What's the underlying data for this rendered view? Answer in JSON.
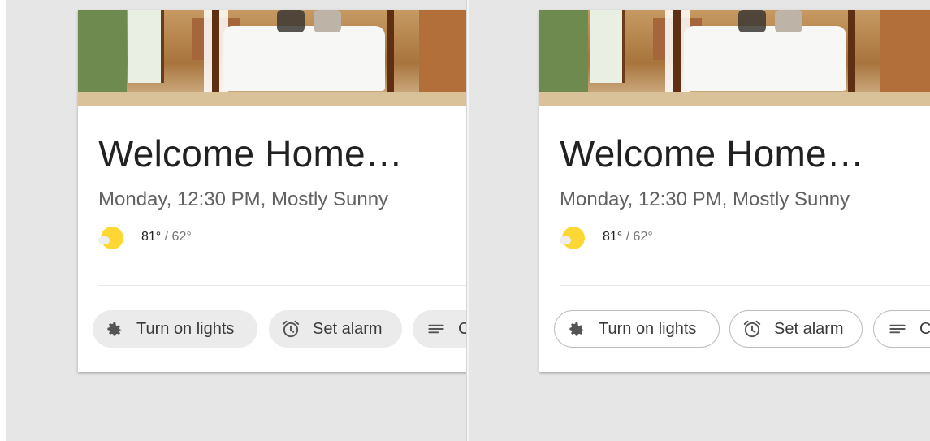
{
  "variants": [
    {
      "style": "filled-chips",
      "card": {
        "title": "Welcome Home…",
        "subtitle": "Monday, 12:30 PM, Mostly Sunny",
        "weather": {
          "high": "81°",
          "low": " / 62°",
          "icon": "partly-sunny-icon"
        },
        "chips": [
          {
            "label": "Turn on lights",
            "icon": "gear-icon"
          },
          {
            "label": "Set alarm",
            "icon": "alarm-icon"
          },
          {
            "label": "C",
            "icon": "menu-icon"
          }
        ]
      }
    },
    {
      "style": "outlined-chips",
      "card": {
        "title": "Welcome Home…",
        "subtitle": "Monday, 12:30 PM, Mostly Sunny",
        "weather": {
          "high": "81°",
          "low": " / 62°",
          "icon": "partly-sunny-icon"
        },
        "chips": [
          {
            "label": "Turn on lights",
            "icon": "gear-icon"
          },
          {
            "label": "Set alarm",
            "icon": "alarm-icon"
          },
          {
            "label": "C",
            "icon": "menu-icon"
          }
        ]
      }
    }
  ],
  "colors": {
    "background": "#e6e6e6",
    "card": "#ffffff",
    "title": "#212121",
    "subtitle": "#616161",
    "sun": "#fdd835",
    "chip_filled": "#ebebeb",
    "chip_outline": "#bdbdbd"
  }
}
